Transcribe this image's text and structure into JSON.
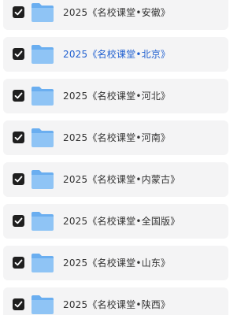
{
  "folders": [
    {
      "label": "2025《名校课堂•安徽》",
      "checked": true,
      "highlighted": false,
      "icon": "folder-icon"
    },
    {
      "label": "2025《名校课堂•北京》",
      "checked": true,
      "highlighted": true,
      "icon": "folder-icon"
    },
    {
      "label": "2025《名校课堂•河北》",
      "checked": true,
      "highlighted": false,
      "icon": "folder-icon"
    },
    {
      "label": "2025《名校课堂•河南》",
      "checked": true,
      "highlighted": false,
      "icon": "folder-icon"
    },
    {
      "label": "2025《名校课堂•内蒙古》",
      "checked": true,
      "highlighted": false,
      "icon": "folder-icon"
    },
    {
      "label": "2025《名校课堂•全国版》",
      "checked": true,
      "highlighted": false,
      "icon": "folder-icon"
    },
    {
      "label": "2025《名校课堂•山东》",
      "checked": true,
      "highlighted": false,
      "icon": "folder-icon"
    },
    {
      "label": "2025《名校课堂•陕西》",
      "checked": true,
      "highlighted": false,
      "icon": "folder-icon"
    }
  ],
  "colors": {
    "row_bg": "#f4f4f5",
    "text": "#333333",
    "highlight_text": "#1f5fd0",
    "checkbox": "#1f1f1f",
    "folder_light": "#8fc4f5",
    "folder_dark": "#6aaef0"
  }
}
